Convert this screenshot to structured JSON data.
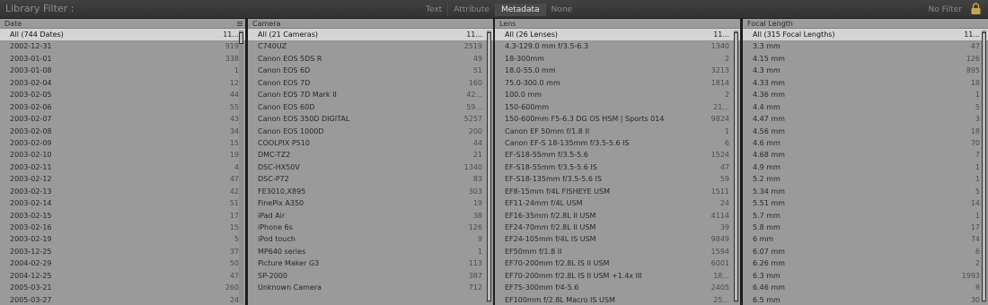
{
  "filter_bar": {
    "title": "Library Filter :",
    "modes": [
      {
        "label": "Text",
        "active": false
      },
      {
        "label": "Attribute",
        "active": false
      },
      {
        "label": "Metadata",
        "active": true
      },
      {
        "label": "None",
        "active": false
      }
    ],
    "preset": "No Filter",
    "lock_icon": "lock-icon"
  },
  "columns": [
    {
      "header": "Date",
      "all_label": "All (744 Dates)",
      "all_count": "11...",
      "rows": [
        {
          "label": "2002-12-31",
          "count": "919"
        },
        {
          "label": "2003-01-01",
          "count": "338"
        },
        {
          "label": "2003-01-08",
          "count": "1"
        },
        {
          "label": "2003-02-04",
          "count": "12"
        },
        {
          "label": "2003-02-05",
          "count": "44"
        },
        {
          "label": "2003-02-06",
          "count": "55"
        },
        {
          "label": "2003-02-07",
          "count": "43"
        },
        {
          "label": "2003-02-08",
          "count": "34"
        },
        {
          "label": "2003-02-09",
          "count": "15"
        },
        {
          "label": "2003-02-10",
          "count": "19"
        },
        {
          "label": "2003-02-11",
          "count": "4"
        },
        {
          "label": "2003-02-12",
          "count": "47"
        },
        {
          "label": "2003-02-13",
          "count": "42"
        },
        {
          "label": "2003-02-14",
          "count": "51"
        },
        {
          "label": "2003-02-15",
          "count": "17"
        },
        {
          "label": "2003-02-16",
          "count": "15"
        },
        {
          "label": "2003-02-19",
          "count": "5"
        },
        {
          "label": "2003-12-25",
          "count": "37"
        },
        {
          "label": "2004-02-29",
          "count": "50"
        },
        {
          "label": "2004-12-25",
          "count": "47"
        },
        {
          "label": "2005-03-21",
          "count": "260"
        },
        {
          "label": "2005-03-27",
          "count": "24"
        }
      ]
    },
    {
      "header": "Camera",
      "all_label": "All (21 Cameras)",
      "all_count": "11...",
      "rows": [
        {
          "label": "C740UZ",
          "count": "2519"
        },
        {
          "label": "Canon EOS 5DS R",
          "count": "49"
        },
        {
          "label": "Canon EOS 6D",
          "count": "51"
        },
        {
          "label": "Canon EOS 7D",
          "count": "160"
        },
        {
          "label": "Canon EOS 7D Mark II",
          "count": "42..."
        },
        {
          "label": "Canon EOS 60D",
          "count": "59..."
        },
        {
          "label": "Canon EOS 350D DIGITAL",
          "count": "5257"
        },
        {
          "label": "Canon EOS 1000D",
          "count": "200"
        },
        {
          "label": "COOLPIX P510",
          "count": "44"
        },
        {
          "label": "DMC-TZ2",
          "count": "21"
        },
        {
          "label": "DSC-HX50V",
          "count": "1340"
        },
        {
          "label": "DSC-P72",
          "count": "83"
        },
        {
          "label": "FE3010,X895",
          "count": "303"
        },
        {
          "label": "FinePix A350",
          "count": "19"
        },
        {
          "label": "iPad Air",
          "count": "38"
        },
        {
          "label": "iPhone 6s",
          "count": "126"
        },
        {
          "label": "iPod touch",
          "count": "9"
        },
        {
          "label": "MP640 series",
          "count": "1"
        },
        {
          "label": "Picture Maker G3",
          "count": "113"
        },
        {
          "label": "SP-2000",
          "count": "387"
        },
        {
          "label": "Unknown Camera",
          "count": "712"
        }
      ]
    },
    {
      "header": "Lens",
      "all_label": "All (26 Lenses)",
      "all_count": "11...",
      "rows": [
        {
          "label": "4.3-129.0 mm f/3.5-6.3",
          "count": "1340"
        },
        {
          "label": "18-300mm",
          "count": "2"
        },
        {
          "label": "18.0-55.0 mm",
          "count": "3213"
        },
        {
          "label": "75.0-300.0 mm",
          "count": "1814"
        },
        {
          "label": "100.0 mm",
          "count": "2"
        },
        {
          "label": "150-600mm",
          "count": "21..."
        },
        {
          "label": "150-600mm F5-6.3 DG OS HSM | Sports 014",
          "count": "9824"
        },
        {
          "label": "Canon EF 50mm f/1.8 II",
          "count": "1"
        },
        {
          "label": "Canon EF-S 18-135mm f/3.5-5.6 IS",
          "count": "6"
        },
        {
          "label": "EF-S18-55mm f/3.5-5.6",
          "count": "1524"
        },
        {
          "label": "EF-S18-55mm f/3.5-5.6 IS",
          "count": "47"
        },
        {
          "label": "EF-S18-135mm f/3.5-5.6 IS",
          "count": "59"
        },
        {
          "label": "EF8-15mm f/4L FISHEYE USM",
          "count": "1511"
        },
        {
          "label": "EF11-24mm f/4L USM",
          "count": "24"
        },
        {
          "label": "EF16-35mm f/2.8L II USM",
          "count": "4114"
        },
        {
          "label": "EF24-70mm f/2.8L II USM",
          "count": "39"
        },
        {
          "label": "EF24-105mm f/4L IS USM",
          "count": "9849"
        },
        {
          "label": "EF50mm f/1.8 II",
          "count": "1594"
        },
        {
          "label": "EF70-200mm f/2.8L IS II USM",
          "count": "6001"
        },
        {
          "label": "EF70-200mm f/2.8L IS II USM +1.4x III",
          "count": "18..."
        },
        {
          "label": "EF75-300mm f/4-5.6",
          "count": "2405"
        },
        {
          "label": "EF100mm f/2.8L Macro IS USM",
          "count": "25..."
        }
      ]
    },
    {
      "header": "Focal Length",
      "all_label": "All (315 Focal Lengths)",
      "all_count": "11...",
      "rows": [
        {
          "label": "3.3 mm",
          "count": "47"
        },
        {
          "label": "4.15 mm",
          "count": "126"
        },
        {
          "label": "4.3 mm",
          "count": "895"
        },
        {
          "label": "4.33 mm",
          "count": "18"
        },
        {
          "label": "4.36 mm",
          "count": "1"
        },
        {
          "label": "4.4 mm",
          "count": "5"
        },
        {
          "label": "4.47 mm",
          "count": "3"
        },
        {
          "label": "4.56 mm",
          "count": "18"
        },
        {
          "label": "4.6 mm",
          "count": "70"
        },
        {
          "label": "4.68 mm",
          "count": "7"
        },
        {
          "label": "4.9 mm",
          "count": "1"
        },
        {
          "label": "5.2 mm",
          "count": "1"
        },
        {
          "label": "5.34 mm",
          "count": "5"
        },
        {
          "label": "5.51 mm",
          "count": "14"
        },
        {
          "label": "5.7 mm",
          "count": "1"
        },
        {
          "label": "5.8 mm",
          "count": "17"
        },
        {
          "label": "6 mm",
          "count": "74"
        },
        {
          "label": "6.07 mm",
          "count": "6"
        },
        {
          "label": "6.26 mm",
          "count": "2"
        },
        {
          "label": "6.3 mm",
          "count": "1993"
        },
        {
          "label": "6.46 mm",
          "count": "8"
        },
        {
          "label": "6.5 mm",
          "count": "30"
        }
      ]
    }
  ]
}
